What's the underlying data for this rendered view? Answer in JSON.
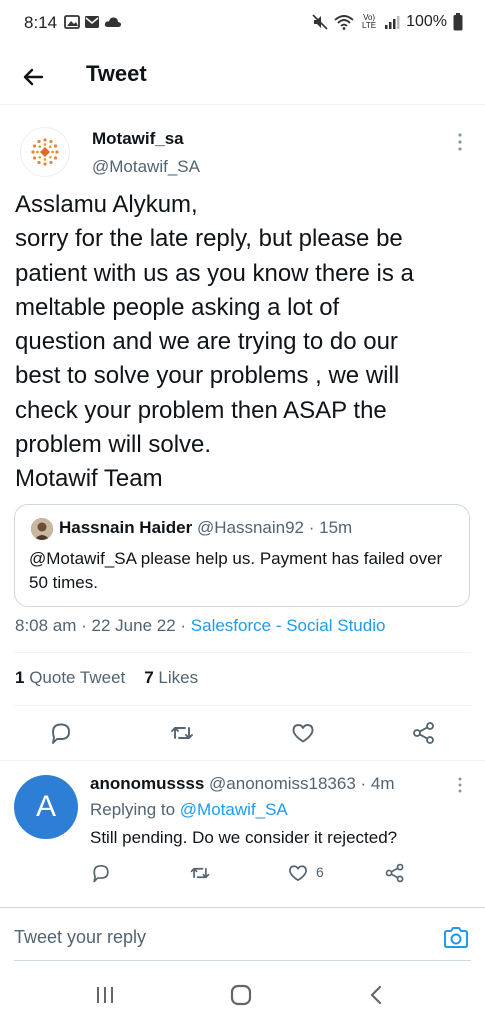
{
  "status_bar": {
    "time": "8:14",
    "battery": "100%",
    "volte_label": "Vo) LTE"
  },
  "header": {
    "title": "Tweet",
    "back_icon": "arrow-left-icon"
  },
  "tweet": {
    "author_name": "Motawif_sa",
    "author_handle": "@Motawif_SA",
    "text_lines": [
      "Asslamu Alykum,",
      "sorry for the late reply, but please be",
      "patient with us as you know there is a",
      "meltable people asking a lot of",
      "question and we are trying to do our",
      "best to solve your problems , we will",
      "check your problem then ASAP the",
      "problem will solve.",
      "Motawif Team"
    ],
    "quote": {
      "name": "Hassnain Haider",
      "handle_time": "@Hassnain92 · 15m",
      "text": "@Motawif_SA please help us. Payment has failed over 50 times."
    },
    "timestamp": "8:08 am · 22 June 22 · ",
    "source": "Salesforce - Social Studio",
    "stats": {
      "quote_count": "1",
      "quote_label": " Quote Tweet",
      "like_count": "7",
      "like_label": " Likes"
    }
  },
  "reply": {
    "avatar_letter": "A",
    "name": "anonomussss",
    "handle_time": " @anonomiss18363 · 4m",
    "replying_prefix": "Replying to ",
    "replying_handle": "@Motawif_SA",
    "text": "Still pending. Do we consider it rejected?",
    "like_count": "6"
  },
  "composer": {
    "placeholder": "Tweet your reply"
  },
  "colors": {
    "accent": "#1d9bf0",
    "secondary_text": "#536471",
    "reply_avatar": "#2d7fd6"
  }
}
